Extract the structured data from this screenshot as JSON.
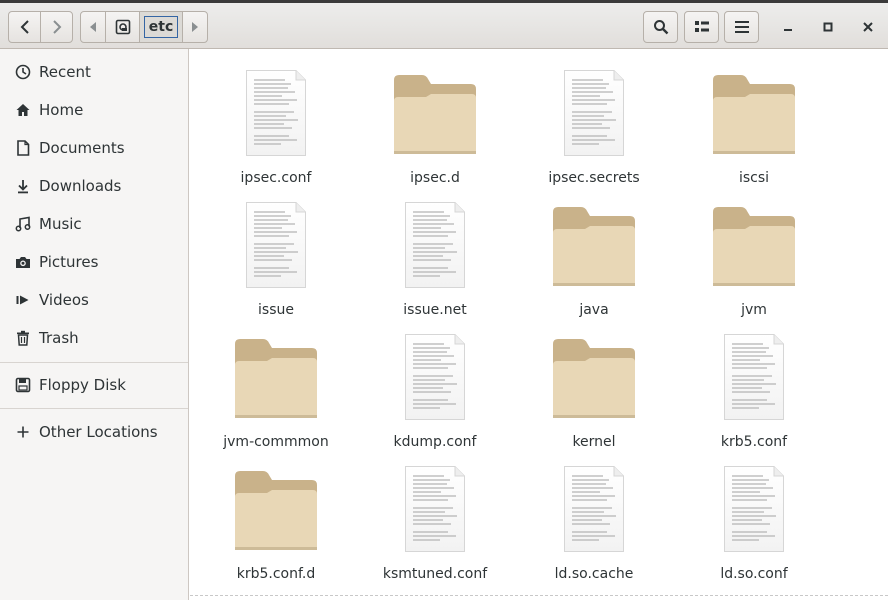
{
  "header": {
    "path_segment": "etc"
  },
  "sidebar": {
    "items": [
      {
        "label": "Recent",
        "icon": "recent-icon"
      },
      {
        "label": "Home",
        "icon": "home-icon"
      },
      {
        "label": "Documents",
        "icon": "documents-icon"
      },
      {
        "label": "Downloads",
        "icon": "downloads-icon"
      },
      {
        "label": "Music",
        "icon": "music-icon"
      },
      {
        "label": "Pictures",
        "icon": "pictures-icon"
      },
      {
        "label": "Videos",
        "icon": "videos-icon"
      },
      {
        "label": "Trash",
        "icon": "trash-icon"
      }
    ],
    "devices": [
      {
        "label": "Floppy Disk",
        "icon": "floppy-disk-icon"
      }
    ],
    "other": [
      {
        "label": "Other Locations",
        "icon": "plus-icon"
      }
    ]
  },
  "files": [
    {
      "name": "ipsec.conf",
      "type": "file"
    },
    {
      "name": "ipsec.d",
      "type": "folder"
    },
    {
      "name": "ipsec.secrets",
      "type": "file"
    },
    {
      "name": "iscsi",
      "type": "folder"
    },
    {
      "name": "issue",
      "type": "file"
    },
    {
      "name": "issue.net",
      "type": "file"
    },
    {
      "name": "java",
      "type": "folder"
    },
    {
      "name": "jvm",
      "type": "folder"
    },
    {
      "name": "jvm-commmon",
      "type": "folder"
    },
    {
      "name": "kdump.conf",
      "type": "file"
    },
    {
      "name": "kernel",
      "type": "folder"
    },
    {
      "name": "krb5.conf",
      "type": "file"
    },
    {
      "name": "krb5.conf.d",
      "type": "folder"
    },
    {
      "name": "ksmtuned.conf",
      "type": "file"
    },
    {
      "name": "ld.so.cache",
      "type": "file"
    },
    {
      "name": "ld.so.conf",
      "type": "file"
    }
  ],
  "colors": {
    "folder_body": "#e8d7b6",
    "folder_tab": "#c9b28a",
    "sidebar_bg": "#f6f5f4",
    "header_bg": "#e6e3e0",
    "path_focus": "#3465a4"
  }
}
